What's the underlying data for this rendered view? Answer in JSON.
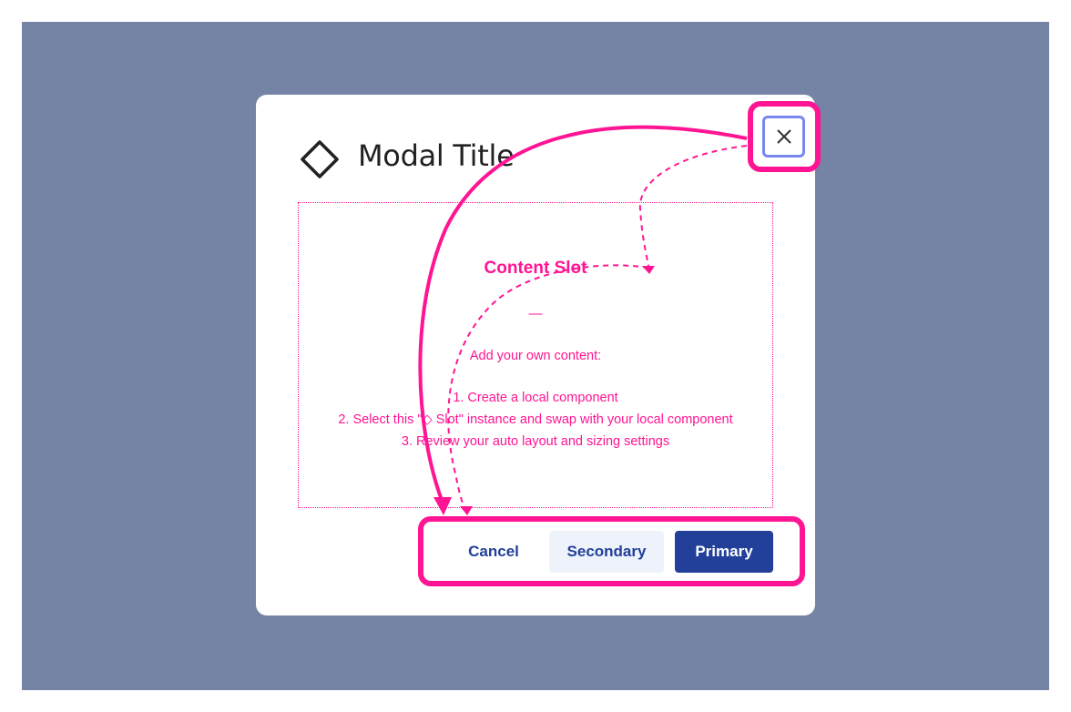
{
  "modal": {
    "title": "Modal Title",
    "close_icon": "close-icon",
    "title_icon": "diamond-icon"
  },
  "slot": {
    "title": "Content Slot",
    "dash": "—",
    "intro": "Add your own content:",
    "steps": [
      "1. Create a local component",
      "2. Select this \"◇ Slot\" instance and swap with your local component",
      "3. Review your auto layout and sizing settings"
    ]
  },
  "footer": {
    "cancel_label": "Cancel",
    "secondary_label": "Secondary",
    "primary_label": "Primary"
  },
  "colors": {
    "backdrop": "#7583a4",
    "annotation": "#ff1493",
    "brand": "#22409a",
    "secondary_bg": "#eef2fb",
    "focus_ring": "#7a86f0"
  }
}
